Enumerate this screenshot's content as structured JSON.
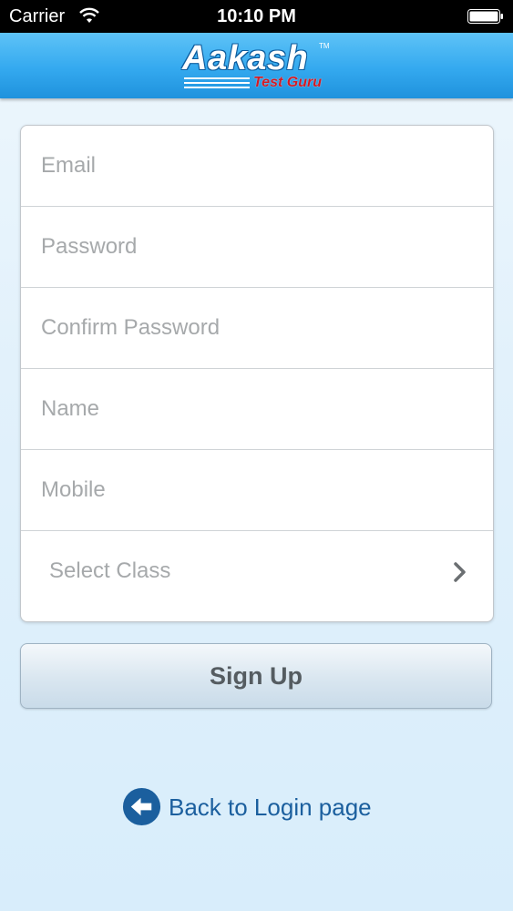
{
  "status_bar": {
    "carrier": "Carrier",
    "time": "10:10 PM",
    "icons": [
      "wifi-icon",
      "battery-icon"
    ]
  },
  "header": {
    "logo_title": "Aakash",
    "logo_subtitle": "Test Guru",
    "logo_trademark": "TM",
    "colors": {
      "bar": "#34a9ef",
      "logo_accent": "#d21a24"
    }
  },
  "form": {
    "fields": [
      {
        "placeholder": "Email",
        "value": ""
      },
      {
        "placeholder": "Password",
        "value": ""
      },
      {
        "placeholder": "Confirm Password",
        "value": ""
      },
      {
        "placeholder": "Name",
        "value": ""
      },
      {
        "placeholder": "Mobile",
        "value": ""
      }
    ],
    "select_class": {
      "label": "Select Class",
      "icon": "chevron-right-icon"
    }
  },
  "signup_button": {
    "label": "Sign Up"
  },
  "back_link": {
    "label": "Back to Login page",
    "icon": "back-arrow-icon",
    "color": "#1b5f9e"
  }
}
